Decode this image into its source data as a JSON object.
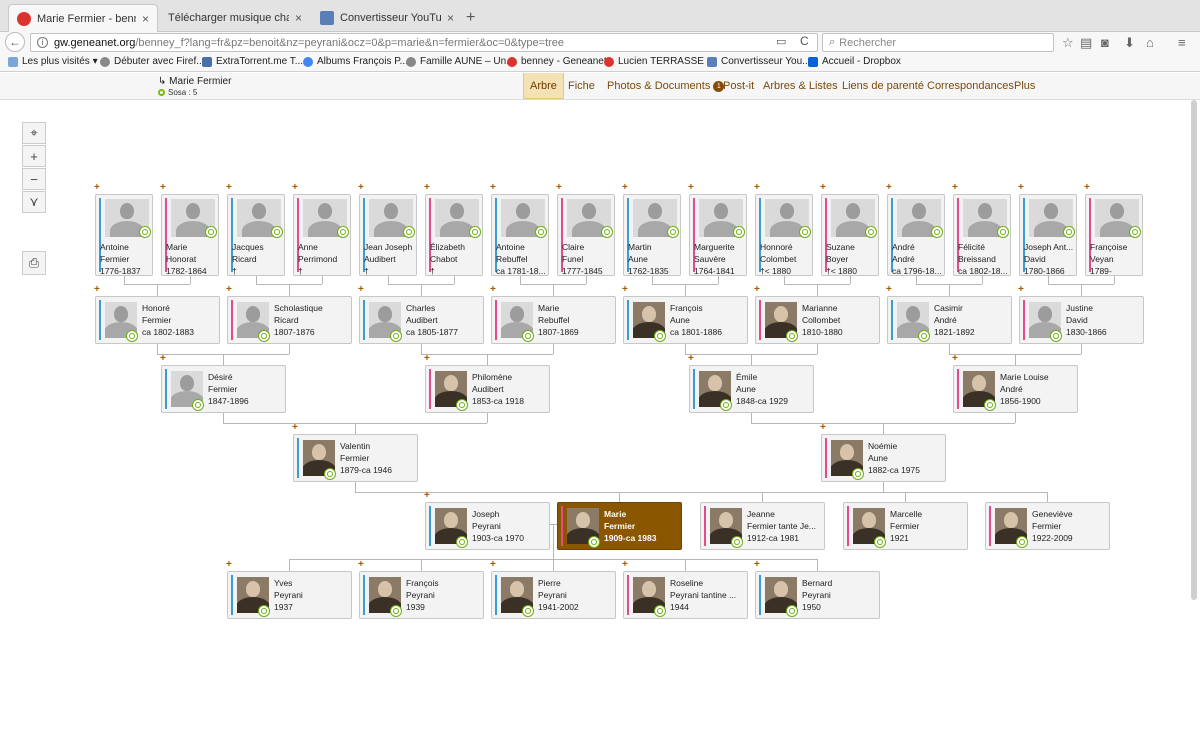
{
  "browser": {
    "tabs": [
      {
        "title": "Marie Fermier - benney - G...",
        "close": "×"
      },
      {
        "title": "Télécharger musique chanson f...",
        "close": "×"
      },
      {
        "title": "Convertisseur YouTube ver...",
        "close": "×"
      }
    ],
    "new_tab": "+",
    "back": "←",
    "url_host": "gw.geneanet.org",
    "url_path": "/benney_f?lang=fr&pz=benoit&nz=peyrani&ocz=0&p=marie&n=fermier&oc=0&type=tree",
    "reload": "C",
    "search_placeholder": "Rechercher",
    "bookmarks": [
      "Les plus visités",
      "Débuter avec Firef...",
      "ExtraTorrent.me T...",
      "Albums François P...",
      "Famille AUNE – Un...",
      "benney - Geneanet",
      "Lucien TERRASSE ...",
      "Convertisseur You...",
      "Accueil - Dropbox"
    ]
  },
  "header": {
    "person": "Marie Fermier",
    "sosa": "Sosa : 5",
    "tabs": [
      "Arbre",
      "Fiche",
      "Photos & Documents",
      "Post-it",
      "Arbres & Listes",
      "Liens de parenté",
      "Correspondances",
      "Plus"
    ],
    "photos_badge": "1"
  },
  "controls": {
    "center": "⌖",
    "zoom_in": "+",
    "zoom_out": "−",
    "expand": "⋎",
    "print": "⎙"
  },
  "tree": {
    "gen4": [
      {
        "lines": [
          "Antoine",
          "Fermier",
          "1776-1837"
        ],
        "sex": "m"
      },
      {
        "lines": [
          "Marie",
          "Honorat",
          "1782-1864"
        ],
        "sex": "f"
      },
      {
        "lines": [
          "Jacques",
          "Ricard",
          "†"
        ],
        "sex": "m"
      },
      {
        "lines": [
          "Anne",
          "Perrimond",
          "†"
        ],
        "sex": "f"
      },
      {
        "lines": [
          "Jean Joseph",
          "Audibert",
          "†"
        ],
        "sex": "m"
      },
      {
        "lines": [
          "Élizabeth",
          "Chabot",
          "†"
        ],
        "sex": "f"
      },
      {
        "lines": [
          "Antoine",
          "Rebuffel",
          "ca 1781-18..."
        ],
        "sex": "m"
      },
      {
        "lines": [
          "Claire",
          "Funel",
          "1777-1845"
        ],
        "sex": "f"
      },
      {
        "lines": [
          "Martin",
          "Aune",
          "1762-1835"
        ],
        "sex": "m"
      },
      {
        "lines": [
          "Marguerite",
          "Sauvère",
          "1764-1841"
        ],
        "sex": "f"
      },
      {
        "lines": [
          "Honnoré",
          "Colombet",
          "†< 1880"
        ],
        "sex": "m"
      },
      {
        "lines": [
          "Suzane",
          "Boyer",
          "†< 1880"
        ],
        "sex": "f"
      },
      {
        "lines": [
          "André",
          "André",
          "ca 1796-18..."
        ],
        "sex": "m"
      },
      {
        "lines": [
          "Félicité",
          "Breissand",
          "ca 1802-18..."
        ],
        "sex": "f"
      },
      {
        "lines": [
          "Joseph Ant...",
          "David",
          "1780-1866"
        ],
        "sex": "m"
      },
      {
        "lines": [
          "Françoise",
          "Veyan",
          "1789-"
        ],
        "sex": "f"
      }
    ],
    "gen3": [
      {
        "lines": [
          "Honoré",
          "Fermier",
          "ca 1802-1883"
        ],
        "sex": "m"
      },
      {
        "lines": [
          "Scholastique",
          "Ricard",
          "1807-1876"
        ],
        "sex": "f"
      },
      {
        "lines": [
          "Charles",
          "Audibert",
          "ca 1805-1877"
        ],
        "sex": "m"
      },
      {
        "lines": [
          "Marie",
          "Rebuffel",
          "1807-1869"
        ],
        "sex": "f"
      },
      {
        "lines": [
          "François",
          "Aune",
          "ca 1801-1886"
        ],
        "sex": "m"
      },
      {
        "lines": [
          "Marianne",
          "Collombet",
          "1810-1880"
        ],
        "sex": "f"
      },
      {
        "lines": [
          "Casimir",
          "André",
          "1821-1892"
        ],
        "sex": "m"
      },
      {
        "lines": [
          "Justine",
          "David",
          "1830-1866"
        ],
        "sex": "f"
      }
    ],
    "gen2": [
      {
        "lines": [
          "Désiré",
          "Fermier",
          "1847-1896"
        ],
        "sex": "m"
      },
      {
        "lines": [
          "Philomène",
          "Audibert",
          "1853-ca 1918"
        ],
        "sex": "f"
      },
      {
        "lines": [
          "Émile",
          "Aune",
          "1848-ca 1929"
        ],
        "sex": "m"
      },
      {
        "lines": [
          "Marie Louise",
          "André",
          "1856-1900"
        ],
        "sex": "f"
      }
    ],
    "gen1": [
      {
        "lines": [
          "Valentin",
          "Fermier",
          "1879-ca 1946"
        ],
        "sex": "m"
      },
      {
        "lines": [
          "Noémie",
          "Aune",
          "1882-ca 1975"
        ],
        "sex": "f"
      }
    ],
    "gen0": [
      {
        "lines": [
          "Joseph",
          "Peyrani",
          "1903-ca 1970"
        ],
        "sex": "m"
      },
      {
        "lines": [
          "Marie",
          "Fermier",
          "1909-ca 1983"
        ],
        "sex": "f"
      },
      {
        "lines": [
          "Jeanne",
          "Fermier tante Je...",
          "1912-ca 1981"
        ],
        "sex": "f"
      },
      {
        "lines": [
          "Marcelle",
          "Fermier",
          "1921"
        ],
        "sex": "f"
      },
      {
        "lines": [
          "Geneviève",
          "Fermier",
          "1922-2009"
        ],
        "sex": "f"
      }
    ],
    "children": [
      {
        "lines": [
          "Yves",
          "Peyrani",
          "1937"
        ],
        "sex": "m"
      },
      {
        "lines": [
          "François",
          "Peyrani",
          "1939"
        ],
        "sex": "m"
      },
      {
        "lines": [
          "Pierre",
          "Peyrani",
          "1941-2002"
        ],
        "sex": "m"
      },
      {
        "lines": [
          "Roseline",
          "Peyrani tantine ...",
          "1944"
        ],
        "sex": "f"
      },
      {
        "lines": [
          "Bernard",
          "Peyrani",
          "1950"
        ],
        "sex": "m"
      }
    ]
  }
}
